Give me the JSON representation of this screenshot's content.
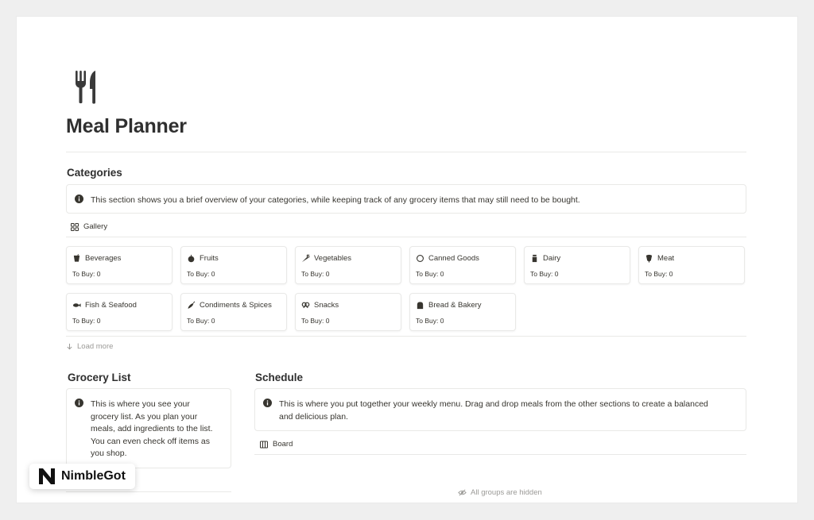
{
  "page": {
    "title": "Meal Planner",
    "icon": "fork-knife-icon"
  },
  "categories": {
    "heading": "Categories",
    "callout": "This section shows you a brief overview of your categories, while keeping track of any grocery items that may still need to be bought.",
    "view_label": "Gallery",
    "load_more": "Load more",
    "items": [
      {
        "name": "Beverages",
        "to_buy": "To Buy: 0",
        "icon": "glass-icon"
      },
      {
        "name": "Fruits",
        "to_buy": "To Buy: 0",
        "icon": "apple-icon"
      },
      {
        "name": "Vegetables",
        "to_buy": "To Buy: 0",
        "icon": "carrot-icon"
      },
      {
        "name": "Canned Goods",
        "to_buy": "To Buy: 0",
        "icon": "circle-icon"
      },
      {
        "name": "Dairy",
        "to_buy": "To Buy: 0",
        "icon": "milk-icon"
      },
      {
        "name": "Meat",
        "to_buy": "To Buy: 0",
        "icon": "meat-icon"
      },
      {
        "name": "Fish & Seafood",
        "to_buy": "To Buy: 0",
        "icon": "fish-icon"
      },
      {
        "name": "Condiments & Spices",
        "to_buy": "To Buy: 0",
        "icon": "pepper-icon"
      },
      {
        "name": "Snacks",
        "to_buy": "To Buy: 0",
        "icon": "pretzel-icon"
      },
      {
        "name": "Bread & Bakery",
        "to_buy": "To Buy: 0",
        "icon": "bread-icon"
      }
    ]
  },
  "grocery": {
    "heading": "Grocery List",
    "callout": "This is where you see your grocery list. As you plan your meals, add ingredients to the list. You can even check off items as you shop."
  },
  "schedule": {
    "heading": "Schedule",
    "callout": "This is where you put together your weekly menu. Drag and drop meals from the other sections to create a balanced and delicious plan.",
    "view_label": "Board",
    "hidden_note": "All groups are hidden"
  },
  "watermark": {
    "text": "NimbleGot"
  }
}
